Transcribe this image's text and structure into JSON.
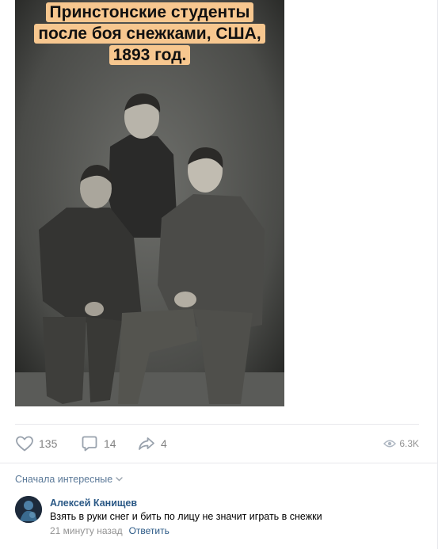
{
  "post": {
    "image": {
      "caption_lines": [
        "Принстонские студенты",
        "после боя снежками, США,",
        "1893 год."
      ]
    },
    "actions": {
      "likes": {
        "icon": "heart-icon",
        "count": "135"
      },
      "comments": {
        "icon": "comment-icon",
        "count": "14"
      },
      "shares": {
        "icon": "share-icon",
        "count": "4"
      },
      "views": {
        "icon": "eye-icon",
        "count": "6.3K"
      }
    }
  },
  "comments_section": {
    "sort_label": "Сначала интересные",
    "items": [
      {
        "author": "Алексей Канищев",
        "text": "Взять в руки снег и бить по лицу не значит играть в снежки",
        "time": "21 минуту назад",
        "reply_label": "Ответить"
      }
    ]
  },
  "colors": {
    "link": "#2a5885",
    "meta": "#939393",
    "caption_bg": "#f7c78f",
    "divider": "#e7e8ec"
  }
}
